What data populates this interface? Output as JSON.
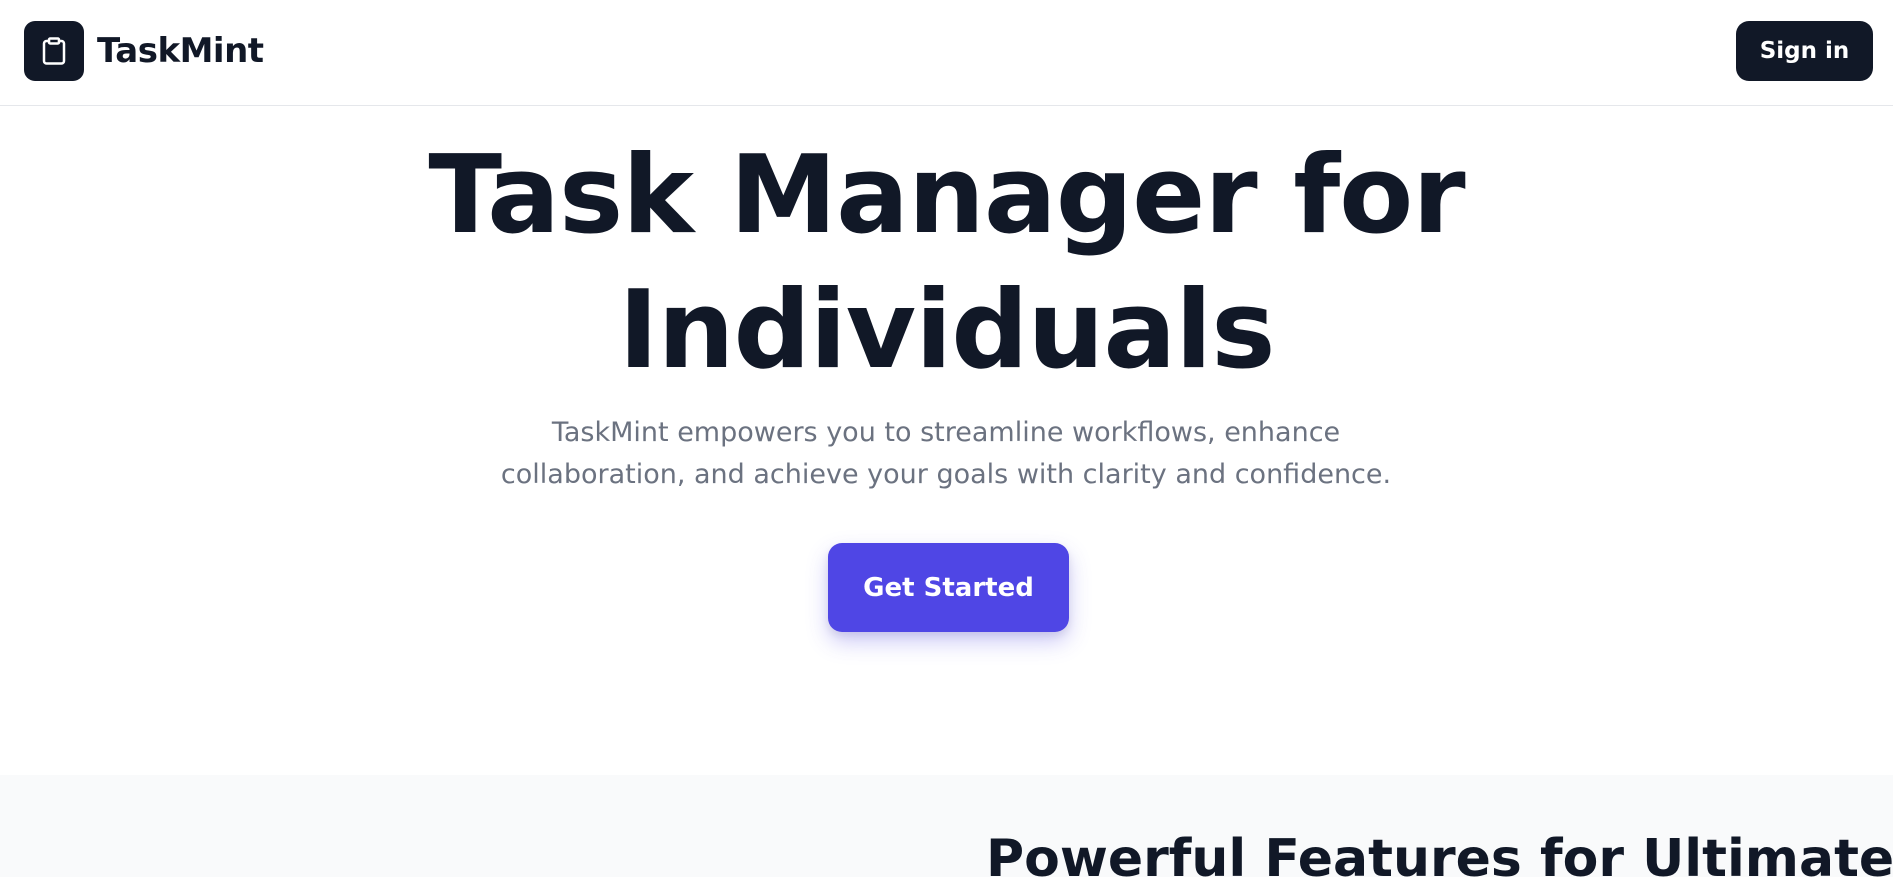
{
  "header": {
    "brand_name": "TaskMint",
    "logo_icon": "clipboard-icon",
    "signin_label": "Sign in"
  },
  "hero": {
    "title_line1": "Task Manager for",
    "title_line2": "Individuals",
    "subtitle_line1": "TaskMint empowers you to streamline workflows, enhance",
    "subtitle_line2": "collaboration, and achieve your goals with clarity and confidence.",
    "cta_label": "Get Started"
  },
  "features": {
    "title": "Powerful Features for Ultimate"
  },
  "colors": {
    "primary_dark": "#111827",
    "accent": "#4f46e5",
    "muted_text": "#6b7280",
    "section_bg": "#f9fafb"
  }
}
